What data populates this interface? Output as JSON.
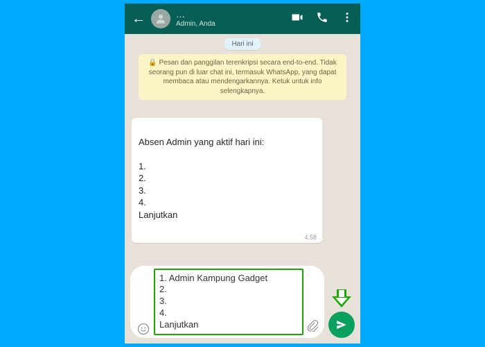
{
  "header": {
    "title": "…",
    "subtitle": "Admin, Anda"
  },
  "day_label": "Hari ini",
  "encryption_notice": "🔒 Pesan dan panggilan terenkripsi secara end-to-end. Tidak seorang pun di luar chat ini, termasuk WhatsApp, yang dapat membaca atau mendengarkannya. Ketuk untuk info selengkapnya.",
  "message": {
    "text": "Absen Admin yang aktif hari ini:\n\n1.\n2.\n3.\n4.\nLanjutkan",
    "time": "4.58"
  },
  "composer": {
    "draft": "1. Admin Kampung Gadget\n2.\n3.\n4.\nLanjutkan"
  }
}
